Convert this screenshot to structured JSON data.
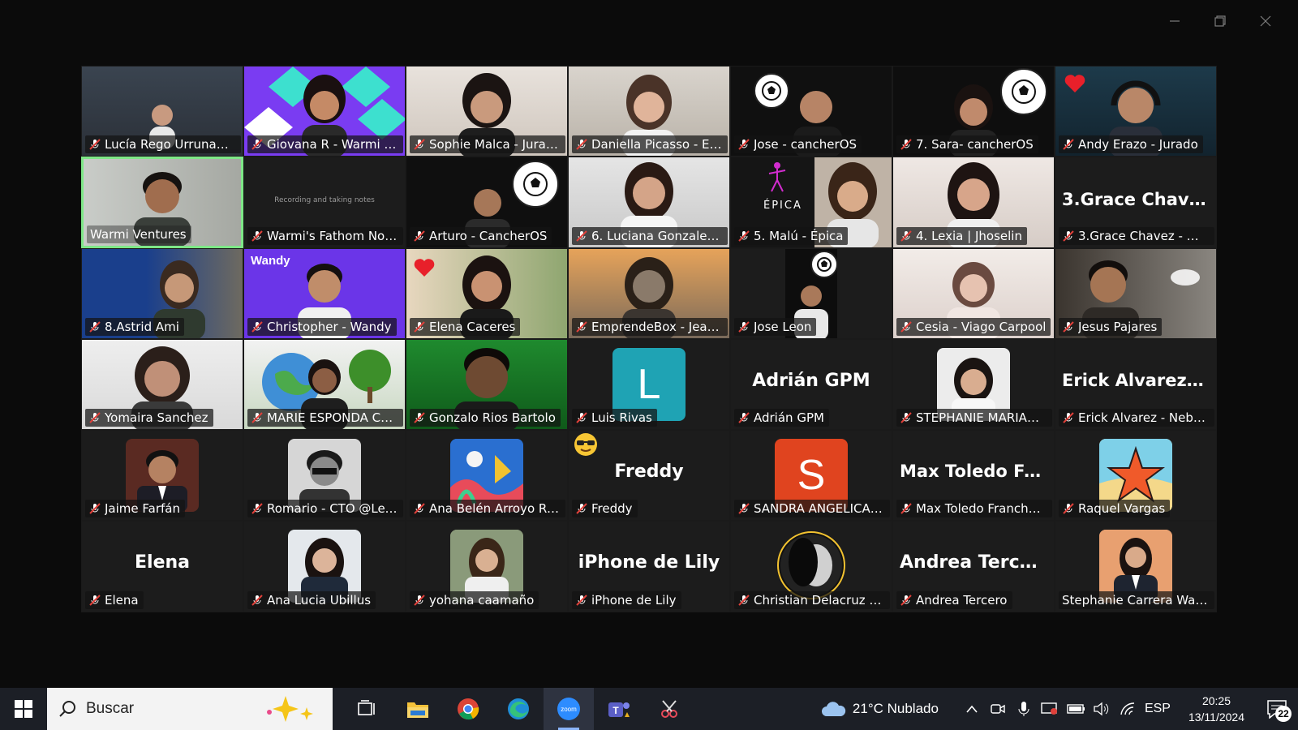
{
  "participants": [
    {
      "name": "Lucía Rego Urrunaga -..."
    },
    {
      "name": "Giovana R - Warmi Ve..."
    },
    {
      "name": "Sophie Malca - Jurado"
    },
    {
      "name": "Daniella Picasso - End..."
    },
    {
      "name": "Jose - cancherOS"
    },
    {
      "name": "7. Sara- cancherOS"
    },
    {
      "name": "Andy Erazo - Jurado"
    },
    {
      "name": "Warmi Ventures"
    },
    {
      "name": "Warmi's Fathom Notet...",
      "tile_text": "Recording and taking notes"
    },
    {
      "name": "Arturo - CancherOS"
    },
    {
      "name": "6. Luciana Gonzalez-P..."
    },
    {
      "name": "5. Malú - Épica",
      "tile_text": "ÉPICA"
    },
    {
      "name": "4. Lexia | Jhoselin"
    },
    {
      "name": "3.Grace Chavez - Wan...",
      "tile_text": "3.Grace  Chavez..."
    },
    {
      "name": "8.Astrid Ami"
    },
    {
      "name": "Christopher - Wandy",
      "tile_text": "Wandy"
    },
    {
      "name": "Elena Caceres"
    },
    {
      "name": "EmprendeBox - Jeamp..."
    },
    {
      "name": "Jose Leon"
    },
    {
      "name": "Cesia - Viago Carpool"
    },
    {
      "name": "Jesus Pajares"
    },
    {
      "name": "Yomaira Sanchez"
    },
    {
      "name": "MARIE ESPONDA COR..."
    },
    {
      "name": "Gonzalo Rios Bartolo"
    },
    {
      "name": "Luis Rivas",
      "tile_text": "L"
    },
    {
      "name": "Adrián GPM",
      "tile_text": "Adrián GPM"
    },
    {
      "name": "STEPHANIE MARIANEL..."
    },
    {
      "name": "Erick Alvarez - Nebula",
      "tile_text": "Erick  Alvarez  -..."
    },
    {
      "name": "Jaime Farfán"
    },
    {
      "name": "Romario - CTO @Lexia"
    },
    {
      "name": "Ana Belén Arroyo Ram..."
    },
    {
      "name": "Freddy",
      "tile_text": "Freddy"
    },
    {
      "name": "SANDRA ANGELICA R...",
      "tile_text": "S"
    },
    {
      "name": "Max Toledo Franchetto",
      "tile_text": "Max  Toledo  Fra..."
    },
    {
      "name": "Raquel Vargas"
    },
    {
      "name": "Elena",
      "tile_text": "Elena"
    },
    {
      "name": "Ana Lucia Ubillus"
    },
    {
      "name": "yohana caamaño"
    },
    {
      "name": "iPhone de Lily",
      "tile_text": "iPhone de Lily"
    },
    {
      "name": "Christian Delacruz // B..."
    },
    {
      "name": "Andrea Tercero",
      "tile_text": "Andrea Tercero"
    },
    {
      "name": "Stephanie Carrera Walling"
    }
  ],
  "taskbar": {
    "search_placeholder": "Buscar",
    "weather": "21°C  Nublado",
    "language": "ESP",
    "time": "20:25",
    "date": "13/11/2024",
    "notification_count": "22"
  },
  "colors": {
    "active_speaker_border": "#7ee787",
    "luis_avatar": "#1fa3b4",
    "sandra_avatar": "#e0441f",
    "taskbar_bg": "#1c1f26"
  }
}
